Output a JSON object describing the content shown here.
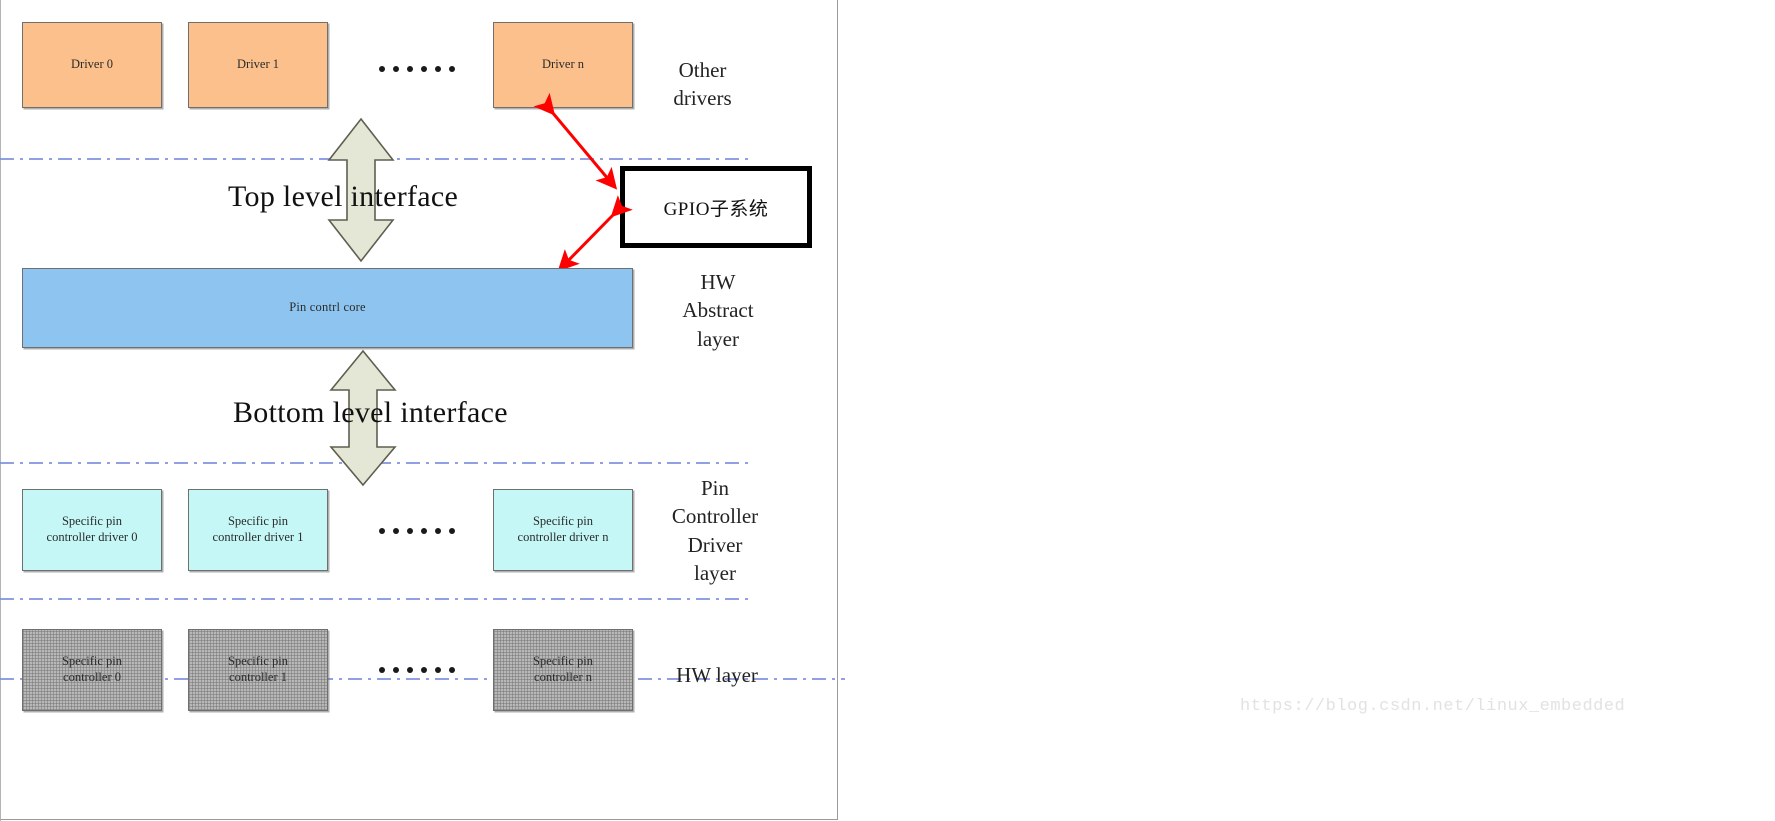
{
  "diagram": {
    "title_watermark": "https://blog.csdn.net/linux_embedded",
    "colors": {
      "driver_box": "#fbc08b",
      "pinctrl_core_box": "#8ec5f0",
      "specific_driver_box": "#c6f7f7",
      "hw_box": "#b8b8b8",
      "divider": "#7d8fe0",
      "arrow_red": "#ff0000",
      "block_arrow_fill": "#e2e6d2"
    },
    "rows": {
      "drivers": {
        "boxes": [
          {
            "label": "Driver 0"
          },
          {
            "label": "Driver 1"
          },
          {
            "label": "Driver n"
          }
        ],
        "ellipsis_dots": 6,
        "side_label": "Other\ndrivers"
      },
      "top_interface": {
        "caption": "Top level interface",
        "arrow": "double-headed-vertical"
      },
      "core": {
        "label": "Pin contrl core",
        "side_label": "HW\nAbstract\nlayer"
      },
      "bottom_interface": {
        "caption": "Bottom level interface",
        "arrow": "double-headed-vertical"
      },
      "specific_drivers": {
        "boxes": [
          {
            "label": "Specific pin\ncontroller driver 0"
          },
          {
            "label": "Specific pin\ncontroller driver 1"
          },
          {
            "label": "Specific pin\ncontroller driver n"
          }
        ],
        "ellipsis_dots": 6,
        "side_label": "Pin\nController\nDriver\nlayer"
      },
      "hardware": {
        "boxes": [
          {
            "label": "Specific pin\ncontroller 0"
          },
          {
            "label": "Specific pin\ncontroller 1"
          },
          {
            "label": "Specific pin\ncontroller n"
          }
        ],
        "ellipsis_dots": 6,
        "side_label": "HW layer"
      }
    },
    "gpio_subsystem": {
      "label": "GPIO子系统"
    }
  }
}
